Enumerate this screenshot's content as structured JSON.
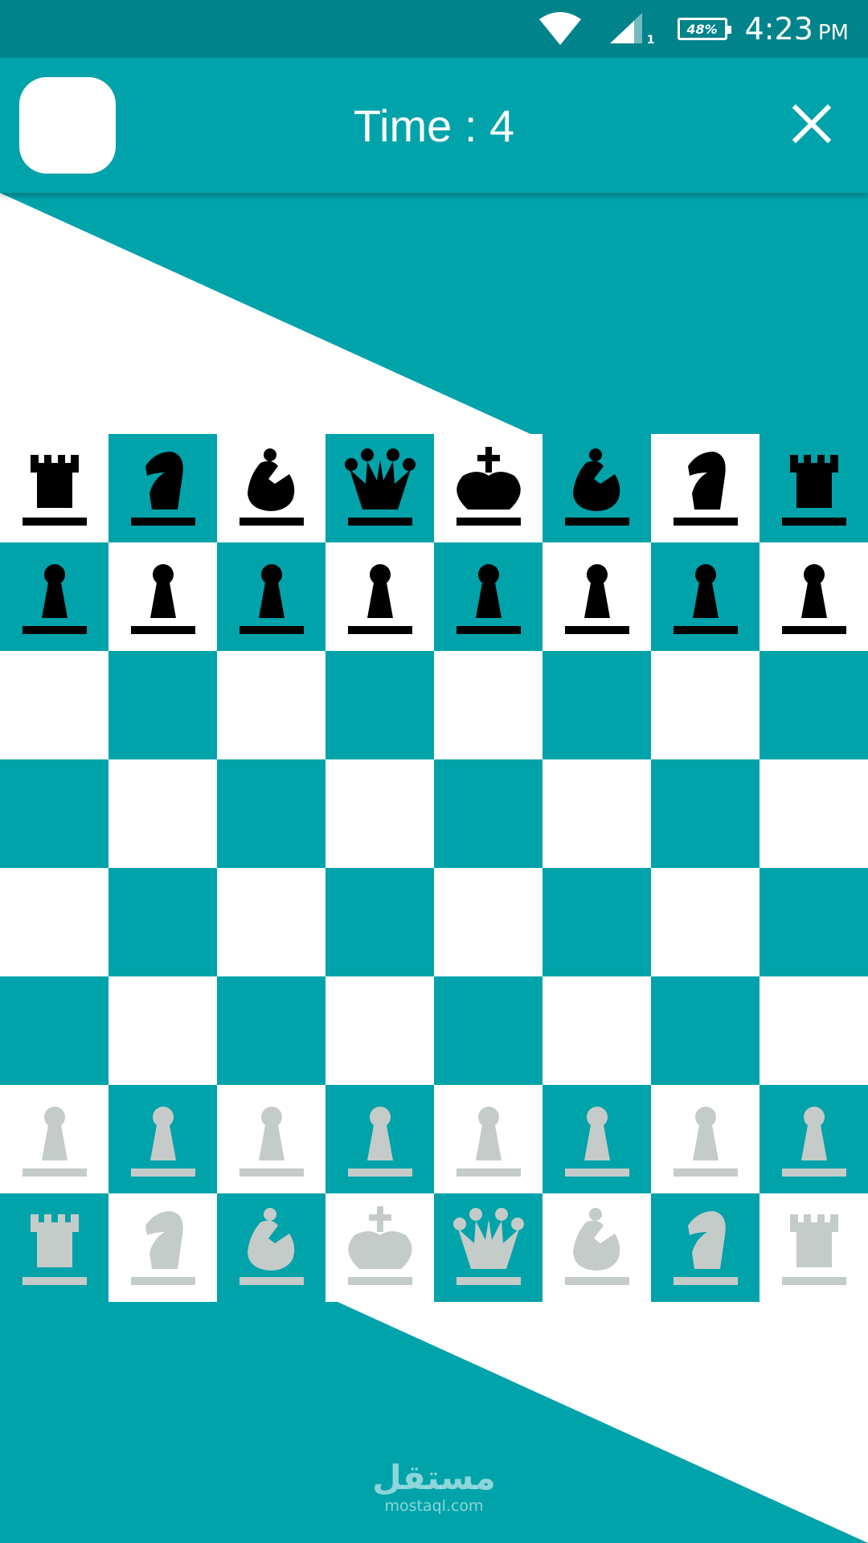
{
  "status_bar": {
    "battery": "48%",
    "sim_index": "1",
    "time": "4:23",
    "ampm": "PM"
  },
  "header": {
    "title": "Time : 4",
    "close_icon": "close-icon"
  },
  "colors": {
    "status_bar": "#00838b",
    "accent": "#00a3aa",
    "light_square": "#ffffff",
    "dark_square": "#00a3aa",
    "black_piece": "#000000",
    "white_piece": "#c5cbc9"
  },
  "board": {
    "rows": [
      [
        "br",
        "bn",
        "bb",
        "bq",
        "bk",
        "bb",
        "bn",
        "br"
      ],
      [
        "bp",
        "bp",
        "bp",
        "bp",
        "bp",
        "bp",
        "bp",
        "bp"
      ],
      [
        "",
        "",
        "",
        "",
        "",
        "",
        "",
        ""
      ],
      [
        "",
        "",
        "",
        "",
        "",
        "",
        "",
        ""
      ],
      [
        "",
        "",
        "",
        "",
        "",
        "",
        "",
        ""
      ],
      [
        "",
        "",
        "",
        "",
        "",
        "",
        "",
        ""
      ],
      [
        "wp",
        "wp",
        "wp",
        "wp",
        "wp",
        "wp",
        "wp",
        "wp"
      ],
      [
        "wr",
        "wn",
        "wb",
        "wk",
        "wq",
        "wb",
        "wn",
        "wr"
      ]
    ]
  },
  "watermark": {
    "arabic": "مستقل",
    "latin": "mostaql.com"
  }
}
